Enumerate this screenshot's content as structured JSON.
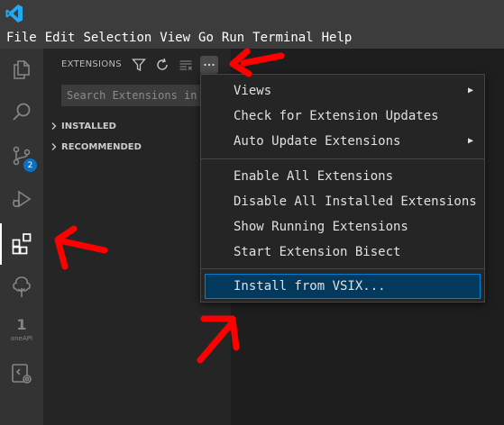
{
  "menubar": {
    "items": [
      "File",
      "Edit",
      "Selection",
      "View",
      "Go",
      "Run",
      "Terminal",
      "Help"
    ]
  },
  "activitybar": {
    "source_control_badge": "2",
    "oneapi_label": "oneAPI",
    "oneapi_number": "1"
  },
  "sidebar": {
    "title": "EXTENSIONS",
    "search_placeholder": "Search Extensions in Ma",
    "sections": [
      "INSTALLED",
      "RECOMMENDED"
    ]
  },
  "menu": {
    "groups": [
      [
        "Views",
        "Check for Extension Updates",
        "Auto Update Extensions"
      ],
      [
        "Enable All Extensions",
        "Disable All Installed Extensions",
        "Show Running Extensions",
        "Start Extension Bisect"
      ],
      [
        "Install from VSIX..."
      ]
    ],
    "submenu_indicator": "▶"
  },
  "colors": {
    "accent": "#007fd4",
    "highlight": "#04395e",
    "annotation_arrow": "#ff0000",
    "badge": "#0e70c0"
  },
  "icons": [
    "vscode-logo",
    "explorer-icon",
    "search-icon",
    "source-control-icon",
    "run-debug-icon",
    "extensions-icon",
    "tree-icon",
    "oneapi-icon",
    "remote-icon",
    "filter-icon",
    "refresh-icon",
    "clear-icon",
    "more-icon"
  ]
}
